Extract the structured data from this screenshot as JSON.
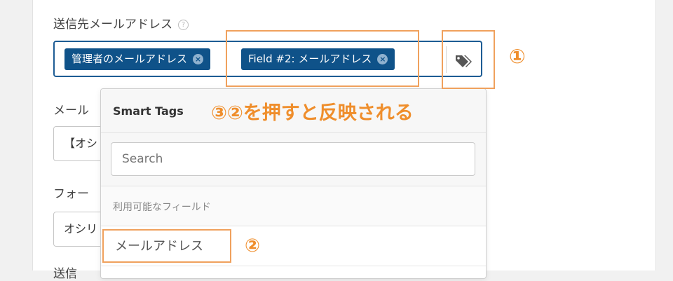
{
  "form": {
    "recipient_label": "送信先メールアドレス",
    "help_glyph": "?",
    "recipient_tags": [
      {
        "label": "管理者のメールアドレス"
      },
      {
        "label": "Field #2: メールアドレス"
      }
    ],
    "remove_glyph": "×",
    "field2_label": "メール",
    "field2_value": "【オシ",
    "field3_label": "フォー",
    "field3_value": "オシリ",
    "field4_label": "送信"
  },
  "smart_tags": {
    "title": "Smart Tags",
    "search_placeholder": "Search",
    "section_label": "利用可能なフィールド",
    "items": [
      {
        "label": "メールアドレス"
      }
    ]
  },
  "annotations": {
    "marker_1": "①",
    "marker_2": "②",
    "instruction": "③②を押すと反映される",
    "color": "#f0a15d"
  }
}
